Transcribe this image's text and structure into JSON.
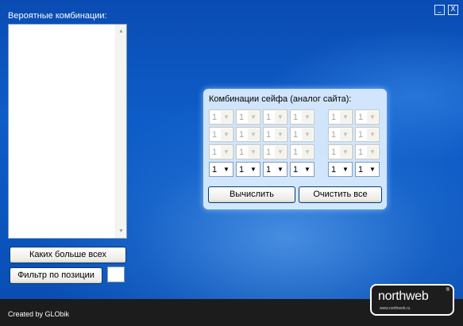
{
  "window_controls": [
    "_",
    "X"
  ],
  "left_panel": {
    "title": "Вероятные комбинации:",
    "items": [],
    "btn_most": "Каких больше всех",
    "btn_filter": "Фильтр по позиции",
    "filter_value": ""
  },
  "safe_panel": {
    "title": "Комбинации сейфа (аналог сайта):",
    "rows": [
      {
        "values": [
          "1",
          "1",
          "1",
          "1",
          "1",
          "1"
        ],
        "enabled": false
      },
      {
        "values": [
          "1",
          "1",
          "1",
          "1",
          "1",
          "1"
        ],
        "enabled": false
      },
      {
        "values": [
          "1",
          "1",
          "1",
          "1",
          "1",
          "1"
        ],
        "enabled": false
      },
      {
        "values": [
          "1",
          "1",
          "1",
          "1",
          "1",
          "1"
        ],
        "enabled": true
      }
    ],
    "btn_calc": "Вычислить",
    "btn_clear": "Очистить все"
  },
  "footer": {
    "credit": "Created by GLObik",
    "logo_word_1": "north",
    "logo_word_2": "web",
    "logo_reg": "®",
    "logo_url": "www.northweb.ru"
  },
  "colors": {
    "background": "#0b57c2",
    "footer": "#1c1c1c",
    "button_border": "#003c74"
  }
}
